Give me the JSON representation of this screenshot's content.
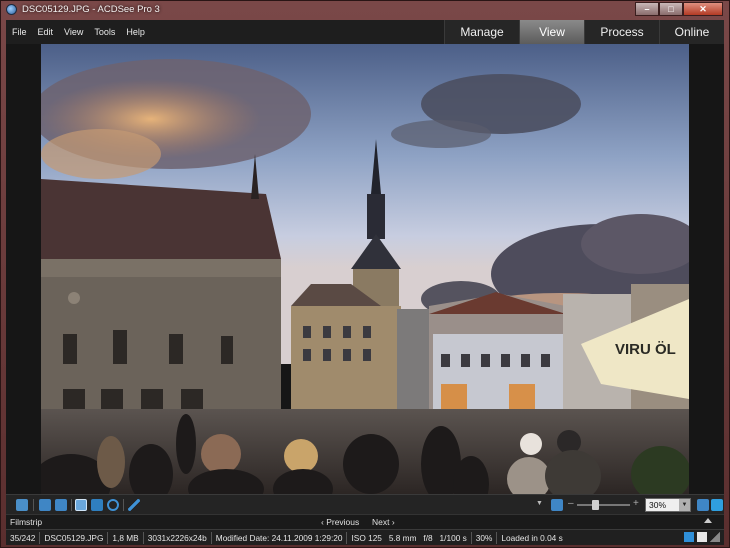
{
  "window": {
    "title": "DSC05129.JPG - ACDSee Pro 3",
    "controls": {
      "minimize": "–",
      "maximize": "□",
      "close": "✕"
    }
  },
  "menu": {
    "items": [
      "File",
      "Edit",
      "View",
      "Tools",
      "Help"
    ]
  },
  "modes": {
    "tabs": [
      "Manage",
      "View",
      "Process",
      "Online"
    ],
    "active": "View"
  },
  "photo_overlay": {
    "umbrella_text": "VIRU ÖL"
  },
  "toolbar": {
    "icons": [
      "filmstrip-icon",
      "rotate-left-icon",
      "rotate-right-icon",
      "hand-tool-icon",
      "select-tool-icon",
      "zoom-tool-icon",
      "fit-icon"
    ],
    "zoom_minus": "–",
    "zoom_plus": "+",
    "zoom_level": "30%",
    "zoom_slider_fraction": 0.3
  },
  "filmstrip": {
    "label": "Filmstrip",
    "previous": "‹ Previous",
    "next": "Next ›"
  },
  "status": {
    "position": "35/242",
    "filename": "DSC05129.JPG",
    "filesize": "1,8 MB",
    "dimensions": "3031x2226x24b",
    "modified": "Modified Date: 24.11.2009 1:29:20",
    "exif": "ISO 125   5.8 mm   f/8   1/100 s",
    "zoom": "30%",
    "load_time": "Loaded in 0.04 s"
  },
  "colors": {
    "window_frame": "#6b3a3a",
    "active_tab": "#7a7a7a",
    "accent_blue": "#2f8fd8"
  }
}
